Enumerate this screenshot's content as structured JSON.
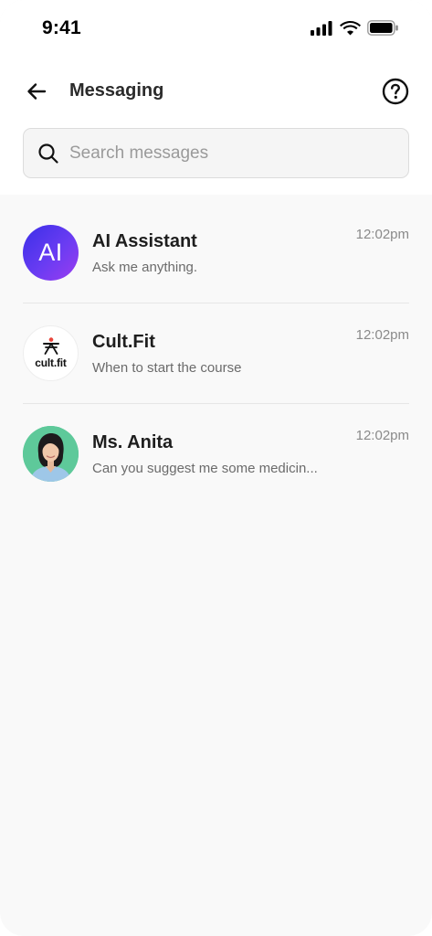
{
  "status_bar": {
    "time": "9:41",
    "icons": [
      "cellular-signal-icon",
      "wifi-icon",
      "battery-icon"
    ]
  },
  "header": {
    "title": "Messaging",
    "back_icon": "arrow-left-icon",
    "help_icon": "question-circle-icon"
  },
  "search": {
    "placeholder": "Search messages",
    "value": ""
  },
  "conversations": [
    {
      "name": "AI Assistant",
      "preview": "Ask me anything.",
      "time": "12:02pm",
      "avatar_text": "AI"
    },
    {
      "name": "Cult.Fit",
      "preview": "When to start the course",
      "time": "12:02pm",
      "avatar_text": "cult.fit"
    },
    {
      "name": "Ms. Anita",
      "preview": "Can you suggest me some medicin...",
      "time": "12:02pm"
    }
  ],
  "colors": {
    "background": "#f9f9f9",
    "ai_gradient_start": "#3a2fe8",
    "ai_gradient_end": "#9b3df0",
    "anita_avatar_bg": "#5ec99a",
    "cult_accent": "#e9453b"
  }
}
